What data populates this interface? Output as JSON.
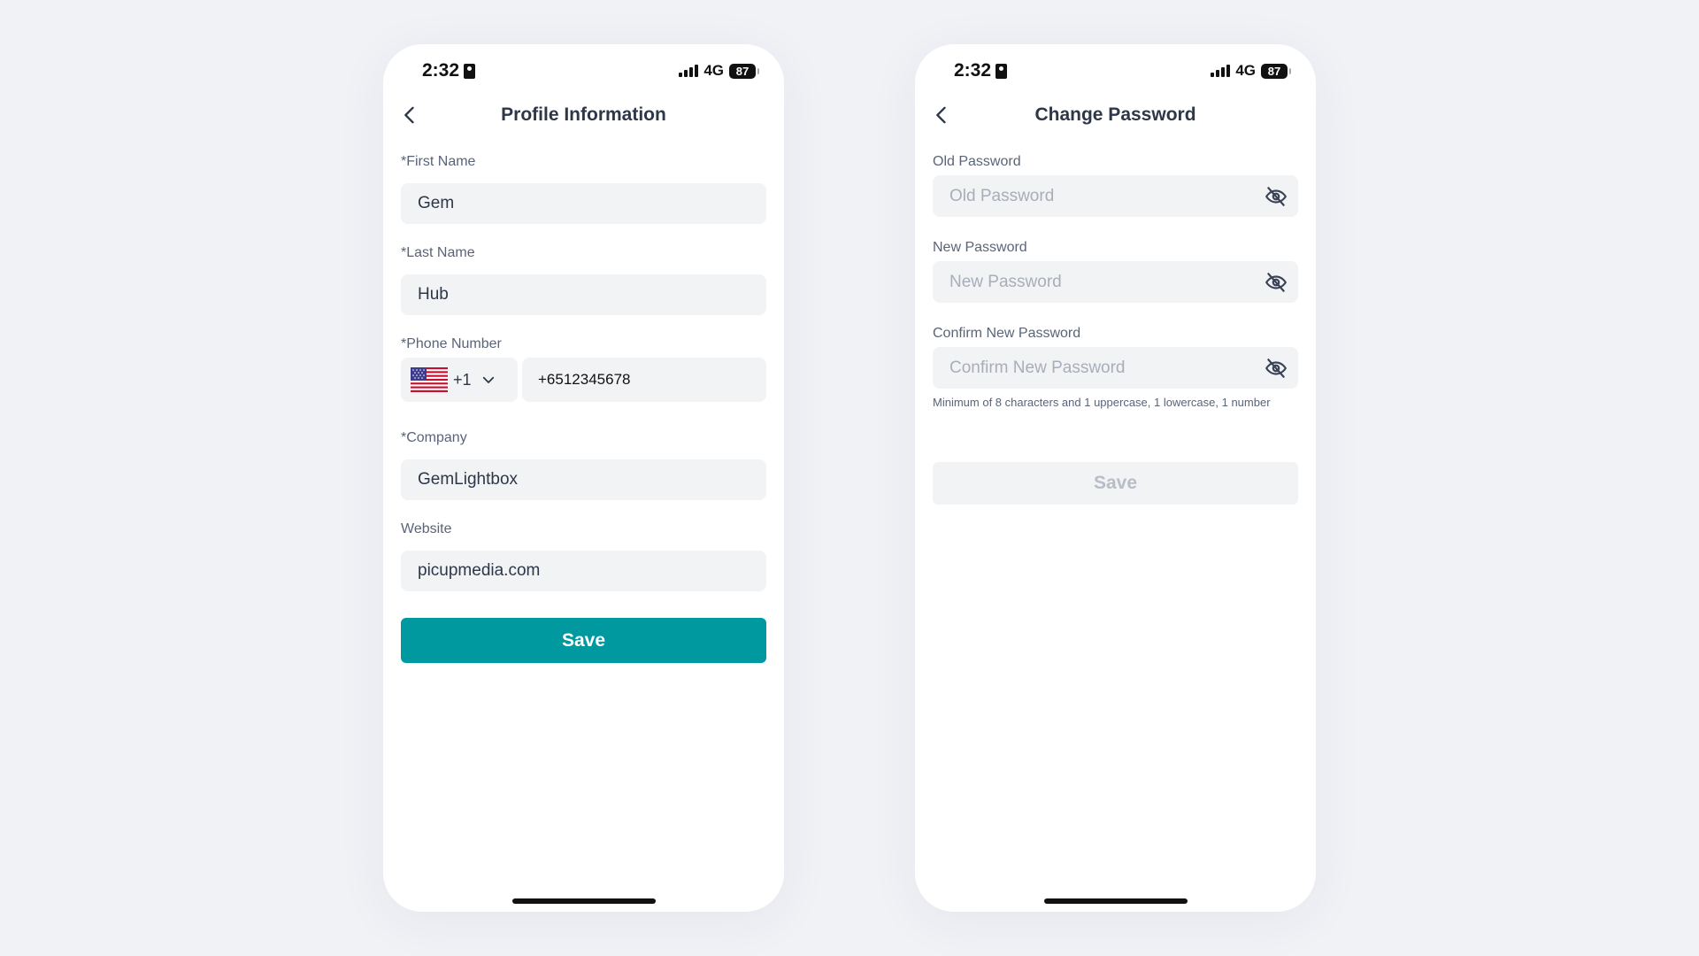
{
  "status_bar": {
    "time": "2:32",
    "network": "4G",
    "battery": "87"
  },
  "profile_screen": {
    "title": "Profile Information",
    "first_name": {
      "label": "*First Name",
      "value": "Gem"
    },
    "last_name": {
      "label": "*Last Name",
      "value": "Hub"
    },
    "phone_number": {
      "label": "*Phone Number",
      "country_code": "+1",
      "flag": "us-flag-icon",
      "value": "+6512345678"
    },
    "company": {
      "label": "*Company",
      "value": "GemLightbox"
    },
    "website": {
      "label": "Website",
      "value": "picupmedia.com"
    },
    "save_label": "Save"
  },
  "password_screen": {
    "title": "Change Password",
    "old_password": {
      "label": "Old Password",
      "placeholder": "Old Password"
    },
    "new_password": {
      "label": "New Password",
      "placeholder": "New Password"
    },
    "confirm_password": {
      "label": "Confirm New Password",
      "placeholder": "Confirm New Password"
    },
    "hint": "Minimum of 8 characters and 1 uppercase, 1 lowercase, 1 number",
    "save_label": "Save"
  },
  "colors": {
    "accent": "#0099a0",
    "background": "#f1f2f6",
    "input_bg": "#f2f3f5",
    "title_text": "#2d3748",
    "label_text": "#5a6478",
    "placeholder_text": "#a8aeb9",
    "disabled_text": "#b8bdc7"
  }
}
